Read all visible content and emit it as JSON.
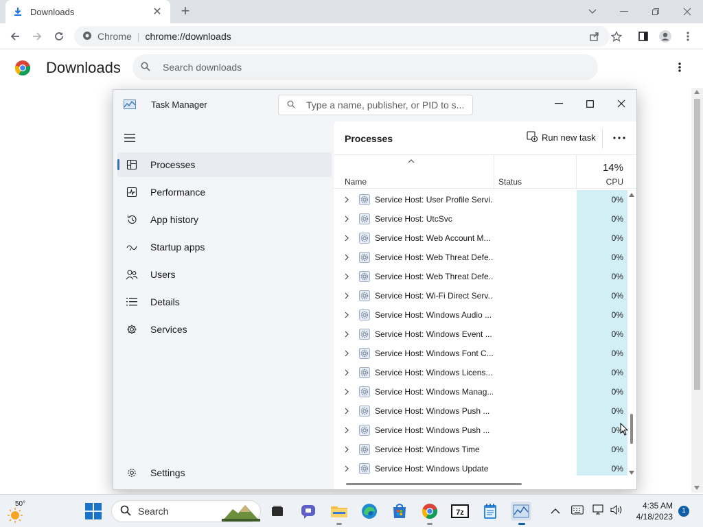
{
  "browser": {
    "tab": {
      "title": "Downloads"
    },
    "omnibox": {
      "site": "Chrome",
      "url": "chrome://downloads"
    }
  },
  "downloads_page": {
    "title": "Downloads",
    "search_placeholder": "Search downloads"
  },
  "task_manager": {
    "title": "Task Manager",
    "search_placeholder": "Type a name, publisher, or PID to s...",
    "nav": [
      {
        "label": "Processes",
        "icon": "processes-icon",
        "active": true
      },
      {
        "label": "Performance",
        "icon": "performance-icon"
      },
      {
        "label": "App history",
        "icon": "history-icon"
      },
      {
        "label": "Startup apps",
        "icon": "startup-icon"
      },
      {
        "label": "Users",
        "icon": "users-icon"
      },
      {
        "label": "Details",
        "icon": "details-icon"
      },
      {
        "label": "Services",
        "icon": "services-icon"
      }
    ],
    "settings_label": "Settings",
    "content": {
      "heading": "Processes",
      "run_new_task": "Run new task",
      "columns": {
        "name": "Name",
        "status": "Status",
        "cpu_total": "14%",
        "cpu": "CPU"
      },
      "rows": [
        {
          "name": "Service Host: User Profile Servi...",
          "cpu": "0%"
        },
        {
          "name": "Service Host: UtcSvc",
          "cpu": "0%"
        },
        {
          "name": "Service Host: Web Account M...",
          "cpu": "0%"
        },
        {
          "name": "Service Host: Web Threat Defe...",
          "cpu": "0%"
        },
        {
          "name": "Service Host: Web Threat Defe...",
          "cpu": "0%"
        },
        {
          "name": "Service Host: Wi-Fi Direct Serv...",
          "cpu": "0%"
        },
        {
          "name": "Service Host: Windows Audio ...",
          "cpu": "0%"
        },
        {
          "name": "Service Host: Windows Event ...",
          "cpu": "0%"
        },
        {
          "name": "Service Host: Windows Font C...",
          "cpu": "0%"
        },
        {
          "name": "Service Host: Windows Licens...",
          "cpu": "0%"
        },
        {
          "name": "Service Host: Windows Manag...",
          "cpu": "0%"
        },
        {
          "name": "Service Host: Windows Push ...",
          "cpu": "0%"
        },
        {
          "name": "Service Host: Windows Push ...",
          "cpu": "0%"
        },
        {
          "name": "Service Host: Windows Time",
          "cpu": "0%"
        },
        {
          "name": "Service Host: Windows Update",
          "cpu": "0%"
        }
      ]
    }
  },
  "taskbar": {
    "weather_temp": "50°",
    "search_label": "Search",
    "clock_time": "4:35 AM",
    "clock_date": "4/18/2023",
    "notification_count": "1"
  },
  "colors": {
    "accent": "#3b6fb6",
    "cpu_column": "#d2eff6",
    "taskbar": "#eef1f6"
  }
}
